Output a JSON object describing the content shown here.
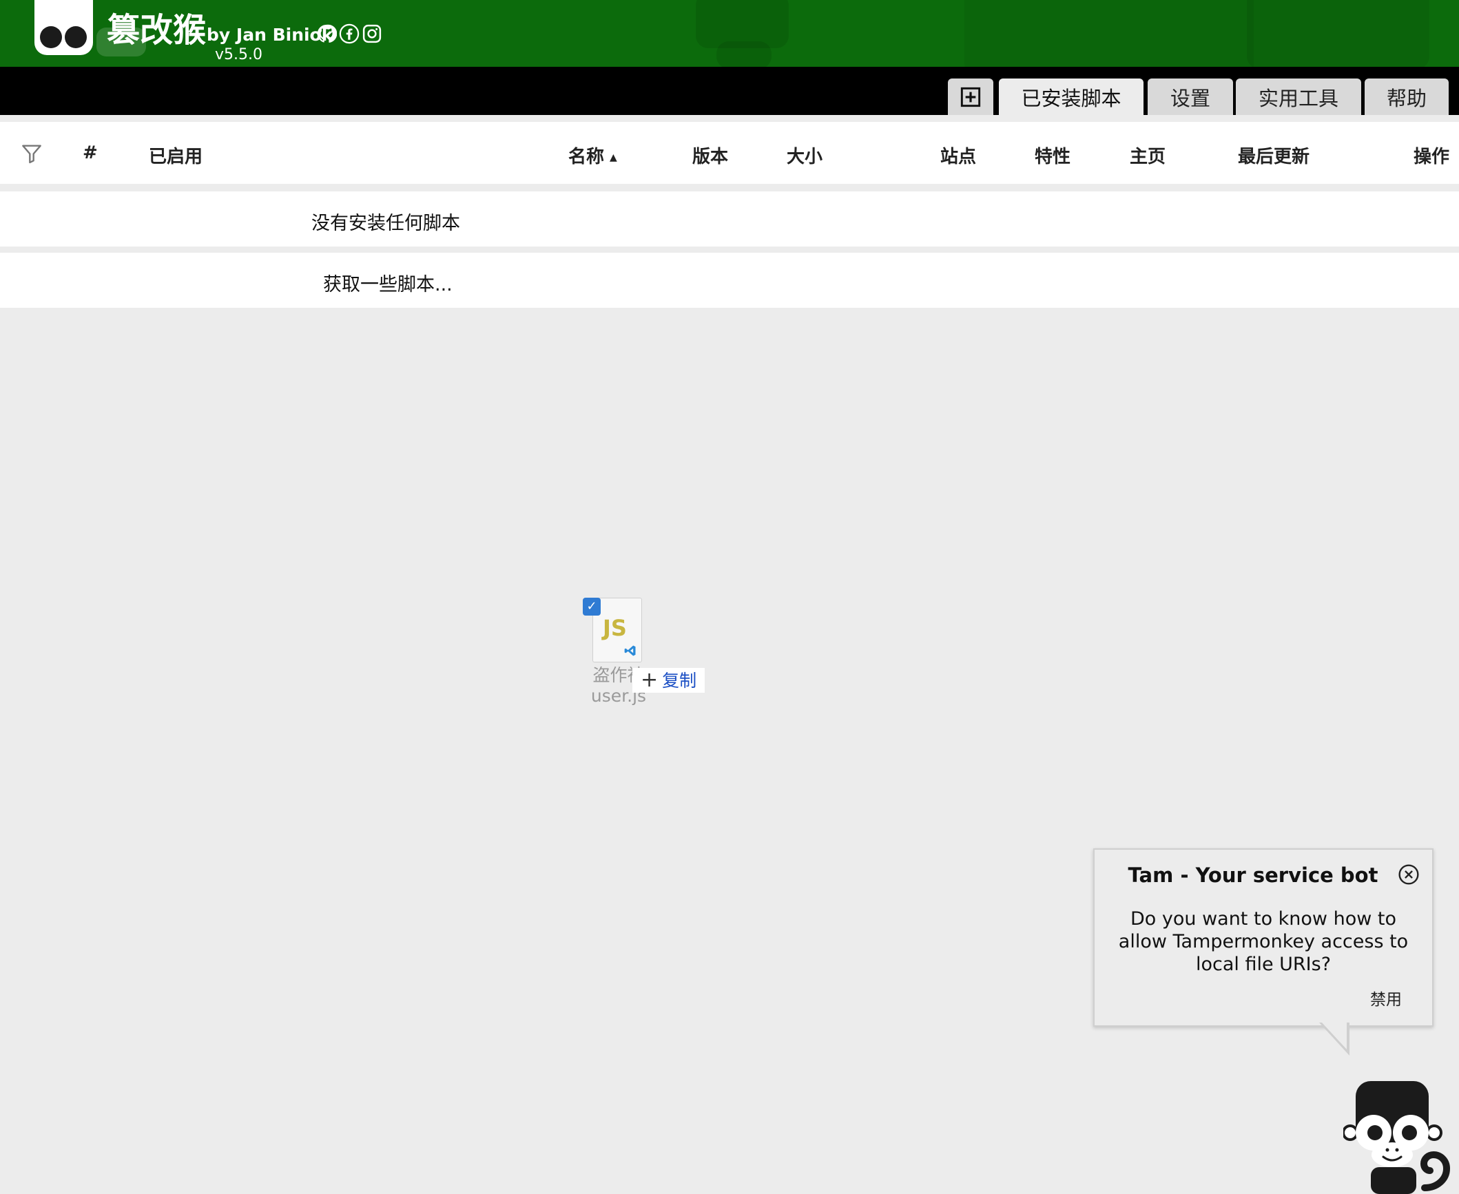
{
  "header": {
    "title": "篡改猴",
    "author": "by Jan Biniok",
    "version": "v5.5.0",
    "social_icons": [
      "github-icon",
      "facebook-icon",
      "instagram-icon"
    ]
  },
  "tabs": {
    "add_icon": "plus-square-icon",
    "items": [
      {
        "label": "已安装脚本",
        "active": true
      },
      {
        "label": "设置",
        "active": false
      },
      {
        "label": "实用工具",
        "active": false
      },
      {
        "label": "帮助",
        "active": false
      }
    ]
  },
  "table": {
    "columns": [
      "#",
      "已启用",
      "名称",
      "版本",
      "大小",
      "站点",
      "特性",
      "主页",
      "最后更新",
      "操作"
    ],
    "sort_indicator": "▲",
    "empty_message": "没有安装任何脚本",
    "get_scripts_link": "获取一些脚本..."
  },
  "drag_file": {
    "icon_text": "JS",
    "name_line1": "盗作神",
    "name_line2": "user.js",
    "action_label": "复制",
    "action_symbol": "+",
    "checkbox": "✓"
  },
  "service_bot": {
    "title": "Tam - Your service bot",
    "message": "Do you want to know how to allow Tampermonkey access to local file URIs?",
    "disable_label": "禁用"
  },
  "colors": {
    "header_bg": "#0c6b0c",
    "tabbar_bg": "#000000",
    "page_bg": "#ececec",
    "link_blue": "#1b4fc4"
  }
}
